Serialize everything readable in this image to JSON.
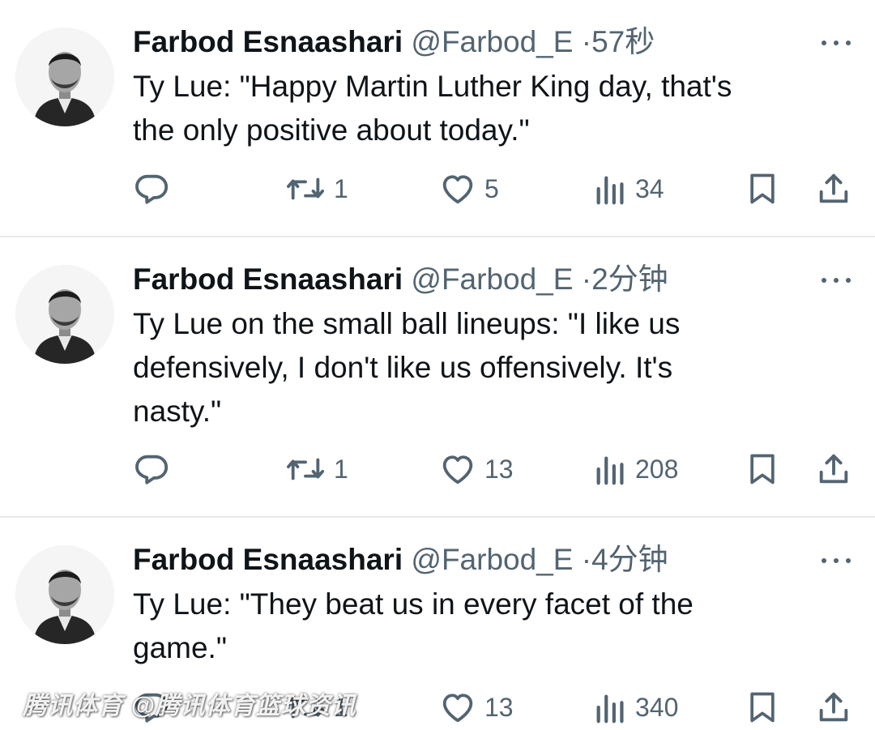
{
  "tweets": [
    {
      "name": "Farbod Esnaashari",
      "handle": "@Farbod_E",
      "dot": "·",
      "time": "57秒",
      "text": "Ty Lue: \"Happy Martin Luther King day, that's\nthe only positive about today.\"",
      "retweets": "1",
      "likes": "5",
      "views": "34"
    },
    {
      "name": "Farbod Esnaashari",
      "handle": "@Farbod_E",
      "dot": "·",
      "time": "2分钟",
      "text": "Ty Lue on the small ball lineups: \"I like us\ndefensively, I don't like us offensively. It's\nnasty.\"",
      "retweets": "1",
      "likes": "13",
      "views": "208"
    },
    {
      "name": "Farbod Esnaashari",
      "handle": "@Farbod_E",
      "dot": "·",
      "time": "4分钟",
      "text": "Ty Lue: \"They beat us in every facet of the\ngame.\"",
      "retweets": "1",
      "likes": "13",
      "views": "340"
    }
  ],
  "watermark": "腾讯体育 @腾讯体育篮球资讯",
  "icons": {
    "reply": "reply-icon",
    "retweet": "retweet-icon",
    "like": "heart-icon",
    "views": "views-icon",
    "bookmark": "bookmark-icon",
    "share": "share-icon",
    "more": "more-icon"
  },
  "colors": {
    "text": "#0f1419",
    "muted": "#536471",
    "divider": "#e7e9ea"
  }
}
